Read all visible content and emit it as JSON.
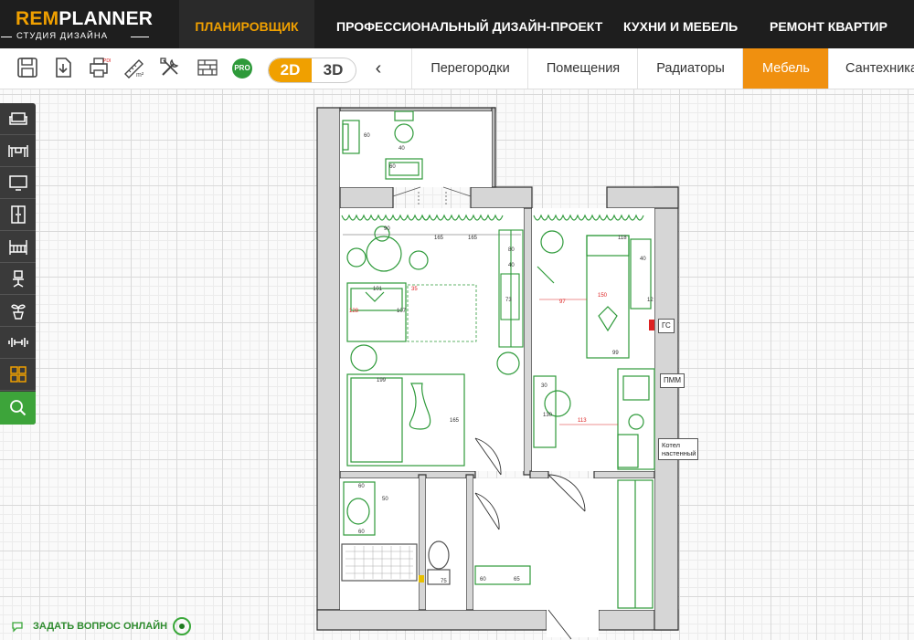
{
  "app": {
    "logo_brand_rem": "REM",
    "logo_brand_planner": "PLANNER",
    "logo_tagline": "СТУДИЯ ДИЗАЙНА"
  },
  "nav": {
    "items": [
      {
        "label": "ПЛАНИРОВЩИК",
        "active": true
      },
      {
        "label": "ПРОФЕССИОНАЛЬНЫЙ ДИЗАЙН-ПРОЕКТ",
        "active": false
      },
      {
        "label": "КУХНИ И МЕБЕЛЬ",
        "active": false
      },
      {
        "label": "РЕМОНТ КВАРТИР",
        "active": false
      }
    ]
  },
  "toolbar": {
    "icons": [
      "save-icon",
      "download-icon",
      "print-pdf-icon",
      "area-m2-icon",
      "tools-icon",
      "bricks-icon"
    ],
    "pro_badge": "PRO",
    "view_2d": "2D",
    "view_3d": "3D",
    "active_view": "2D",
    "collapse": "‹"
  },
  "categories": {
    "items": [
      {
        "label": "Перегородки",
        "active": false
      },
      {
        "label": "Помещения",
        "active": false
      },
      {
        "label": "Радиаторы",
        "active": false
      },
      {
        "label": "Мебель",
        "active": true
      },
      {
        "label": "Сантехника",
        "active": false
      }
    ]
  },
  "toolbox": {
    "tools": [
      "sofa-icon",
      "table-icon",
      "tv-icon",
      "wardrobe-icon",
      "crib-icon",
      "office-chair-icon",
      "plant-icon",
      "dumbbell-icon",
      "grid-icon",
      "search-icon"
    ]
  },
  "plan": {
    "labels": {
      "gs": "ГС",
      "pmm": "ПММ",
      "boiler": "Котел настенный"
    },
    "dims": [
      "90",
      "165",
      "165",
      "80",
      "40",
      "118",
      "40",
      "90",
      "70",
      "60",
      "101",
      "35",
      "128",
      "107",
      "65",
      "73",
      "150",
      "97",
      "26",
      "12",
      "199",
      "165",
      "99",
      "30",
      "60",
      "130",
      "113",
      "60",
      "50",
      "70",
      "75",
      "65",
      "60",
      "115"
    ]
  },
  "chat": {
    "label": "ЗАДАТЬ ВОПРОС ОНЛАЙН"
  },
  "colors": {
    "accent": "#f0a000",
    "tab_active": "#f0900f",
    "nav_bg": "#1e1e1e",
    "furniture": "#2e9a3a",
    "search_tool": "#3da43a"
  }
}
